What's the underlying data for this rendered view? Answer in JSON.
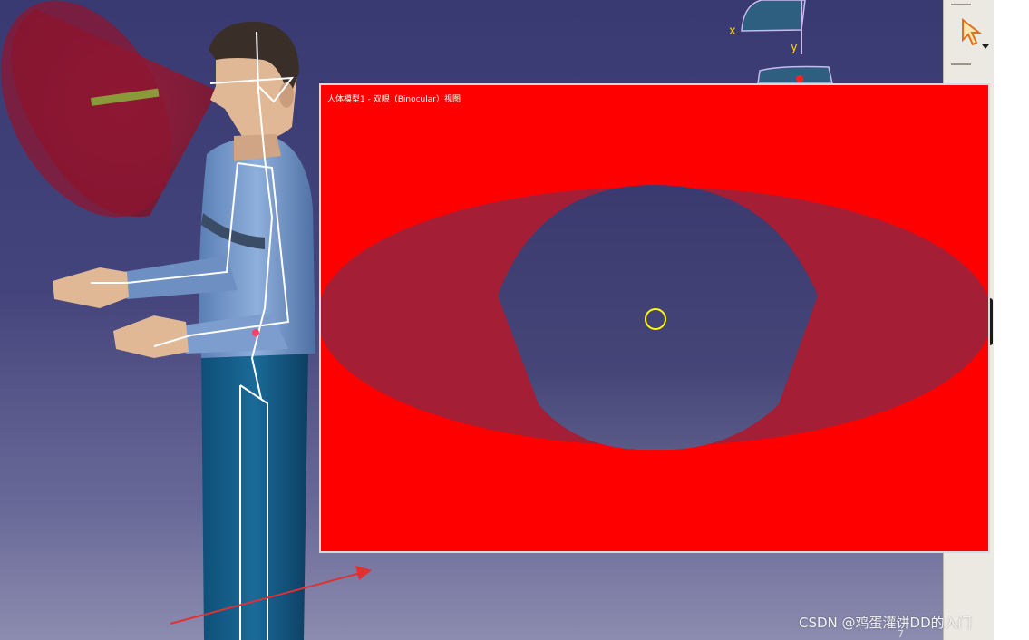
{
  "viewer": {
    "window_title": "人体模型1 - 双眼（Binocular）视图",
    "axis_x": "x",
    "axis_y": "y",
    "bottom_number": "7"
  },
  "toolbar": {
    "select_icon": "select-arrow-icon"
  },
  "watermark": "CSDN @鸡蛋灌饼DD的入门",
  "colors": {
    "viewport_bg": "#3a3a72",
    "binocular_bg": "#ff0000",
    "peripheral_ellipse": "#a41e36",
    "central_vision": "#3e3e72",
    "focus_circle": "#ffff00",
    "vision_cone": "#9b1a33",
    "arrow": "#e03030"
  }
}
